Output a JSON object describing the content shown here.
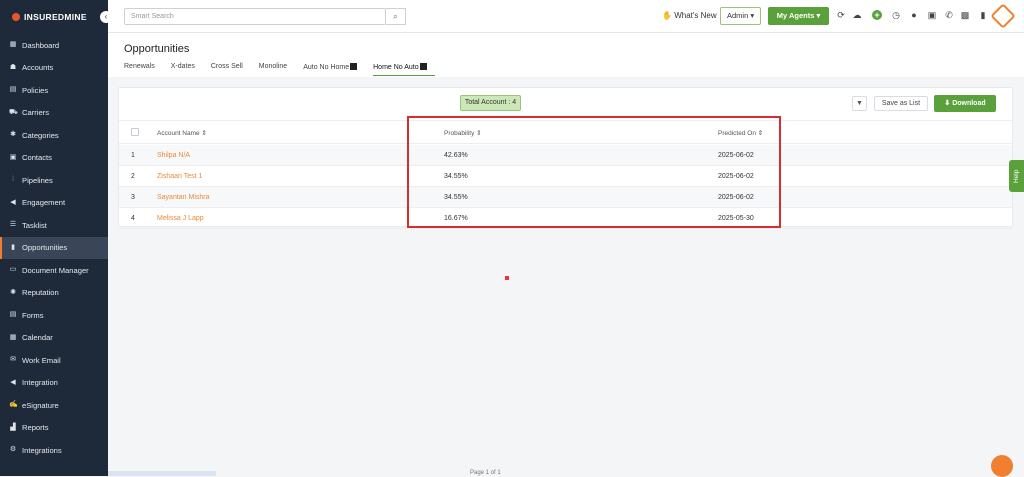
{
  "brand": "INSUREDMINE",
  "sidebar": {
    "items": [
      {
        "label": "Dashboard",
        "icon": "dashboard-icon",
        "glyph": "▦"
      },
      {
        "label": "Accounts",
        "icon": "accounts-icon",
        "glyph": "☗"
      },
      {
        "label": "Policies",
        "icon": "policies-icon",
        "glyph": "▤"
      },
      {
        "label": "Carriers",
        "icon": "carriers-icon",
        "glyph": "⛟"
      },
      {
        "label": "Categories",
        "icon": "categories-icon",
        "glyph": "✱"
      },
      {
        "label": "Contacts",
        "icon": "contacts-icon",
        "glyph": "▣"
      },
      {
        "label": "Pipelines",
        "icon": "pipelines-icon",
        "glyph": "⫶"
      },
      {
        "label": "Engagement",
        "icon": "engagement-icon",
        "glyph": "◀"
      },
      {
        "label": "Tasklist",
        "icon": "tasklist-icon",
        "glyph": "☰"
      },
      {
        "label": "Opportunities",
        "icon": "opportunities-icon",
        "glyph": "▮",
        "active": true
      },
      {
        "label": "Document Manager",
        "icon": "folder-icon",
        "glyph": "▭"
      },
      {
        "label": "Reputation",
        "icon": "reputation-icon",
        "glyph": "✺"
      },
      {
        "label": "Forms",
        "icon": "forms-icon",
        "glyph": "▤"
      },
      {
        "label": "Calendar",
        "icon": "calendar-icon",
        "glyph": "▦"
      },
      {
        "label": "Work Email",
        "icon": "email-icon",
        "glyph": "✉"
      },
      {
        "label": "Integration",
        "icon": "integration-icon",
        "glyph": "◀"
      },
      {
        "label": "eSignature",
        "icon": "esignature-icon",
        "glyph": "✍"
      },
      {
        "label": "Reports",
        "icon": "reports-icon",
        "glyph": "▟"
      },
      {
        "label": "Integrations",
        "icon": "integrations-icon",
        "glyph": "⚙"
      }
    ]
  },
  "topbar": {
    "search_placeholder": "Smart Search",
    "whats_new": "What's New",
    "admin": "Admin",
    "my_agents": "My Agents"
  },
  "page": {
    "title": "Opportunities",
    "tabs": [
      "Renewals",
      "X-dates",
      "Cross Sell",
      "Monoline",
      "Auto No Home",
      "Home No Auto"
    ]
  },
  "toolbar": {
    "total": "Total Account : 4",
    "save_as_list": "Save as List",
    "download": "Download"
  },
  "table": {
    "headers": [
      "Account Name",
      "Probability",
      "Predicted On"
    ],
    "rows": [
      {
        "num": "1",
        "name": "Shilpa N/A",
        "probability": "42.63%",
        "predicted": "2025-06-02"
      },
      {
        "num": "2",
        "name": "Zishaan Test 1",
        "probability": "34.55%",
        "predicted": "2025-06-02"
      },
      {
        "num": "3",
        "name": "Sayantan Mishra",
        "probability": "34.55%",
        "predicted": "2025-06-02"
      },
      {
        "num": "4",
        "name": "Melissa J Lapp",
        "probability": "16.67%",
        "predicted": "2025-05-30"
      }
    ]
  },
  "help": "Help",
  "footer": {
    "pagination": "Page 1 of 1"
  }
}
